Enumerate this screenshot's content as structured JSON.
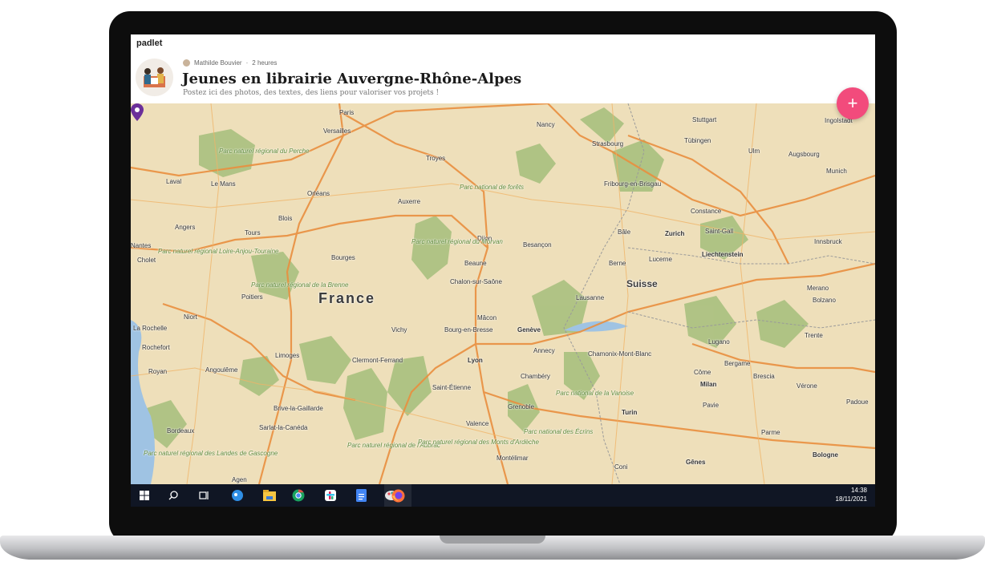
{
  "app": {
    "brand": "padlet"
  },
  "post": {
    "author": "Mathilde Bouvier",
    "time": "2 heures",
    "title": "Jeunes en librairie Auvergne-Rhône-Alpes",
    "subtitle": "Postez ici des photos, des textes, des liens pour valoriser vos projets !"
  },
  "fab": {
    "label": "+"
  },
  "map": {
    "country_main": "France",
    "countries": [
      "Suisse",
      "Liechtenstein"
    ],
    "cities": [
      "Paris",
      "Versailles",
      "Nancy",
      "Stuttgart",
      "Ingolstadt",
      "Strasbourg",
      "Tübingen",
      "Ulm",
      "Augsbourg",
      "Munich",
      "Troyes",
      "Le Mans",
      "Laval",
      "Orléans",
      "Auxerre",
      "Fribourg-en-Brisgau",
      "Blois",
      "Angers",
      "Tours",
      "Constance",
      "Dijon",
      "Besançon",
      "Bâle",
      "Zurich",
      "Saint-Gall",
      "Innsbruck",
      "Nantes",
      "Cholet",
      "Bourges",
      "Beaune",
      "Berne",
      "Lucerne",
      "Chalon-sur-Saône",
      "Poitiers",
      "Niort",
      "La Rochelle",
      "Mâcon",
      "Lausanne",
      "Merano",
      "Bolzano",
      "Vichy",
      "Bourg-en-Bresse",
      "Genève",
      "Trente",
      "Lugano",
      "Rochefort",
      "Limoges",
      "Clermont-Ferrand",
      "Annecy",
      "Chamonix-Mont-Blanc",
      "Royan",
      "Angoulême",
      "Lyon",
      "Chambéry",
      "Côme",
      "Bergame",
      "Brescia",
      "Saint-Étienne",
      "Milan",
      "Vérone",
      "Padoue",
      "Brive-la-Gaillarde",
      "Grenoble",
      "Pavie",
      "Turin",
      "Sarlat-la-Canéda",
      "Valence",
      "Bordeaux",
      "Parme",
      "Montélimar",
      "Coni",
      "Gênes",
      "Bologne",
      "Agen"
    ],
    "parks": [
      "Parc naturel régional du Perche",
      "Parc national de forêts",
      "Parc naturel régional du Morvan",
      "Parc naturel régional Loire-Anjou-Touraine",
      "Parc naturel régional de la Brenne",
      "Parc national de la Vanoise",
      "Parc national des Écrins",
      "Parc naturel régional de l'Aubrac",
      "Parc naturel régional des Monts d'Ardèche",
      "Parc naturel régional des Landes de Gascogne"
    ],
    "pin_location": "Lyon"
  },
  "taskbar": {
    "time": "14:38",
    "date": "18/11/2021"
  }
}
